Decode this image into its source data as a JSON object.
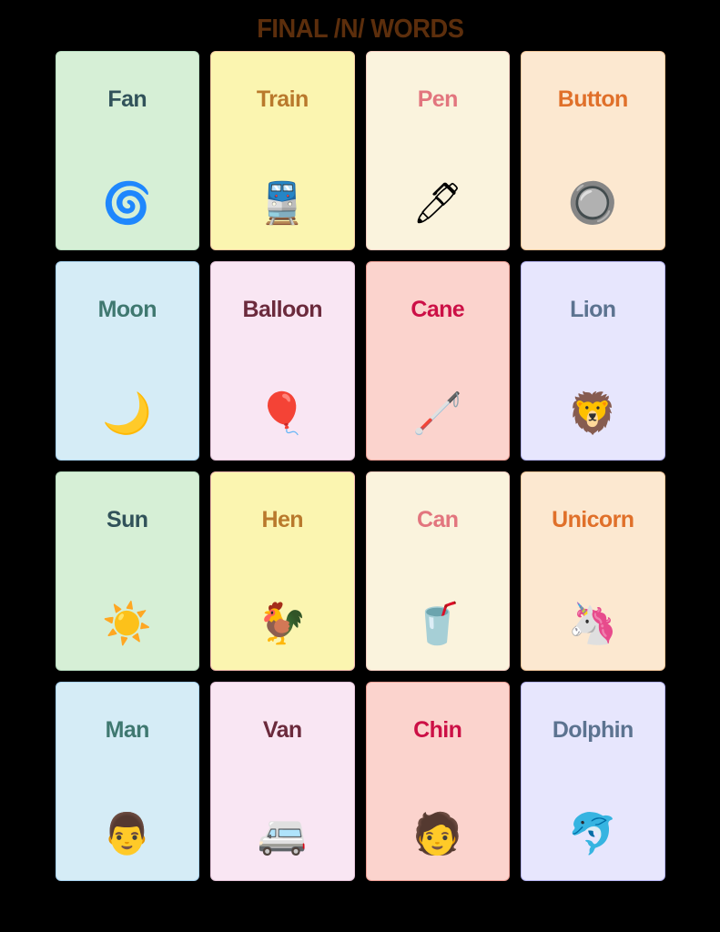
{
  "page": {
    "title": "FINAL /N/ WORDS",
    "title_color": "#5c2e0c",
    "background_color": "#000000"
  },
  "cards": [
    {
      "word": "Fan",
      "emoji": "🌀",
      "icon_name": "fan-icon",
      "bg": "#d6efd6",
      "border": "#b8dcc0",
      "text_color": "#31525a"
    },
    {
      "word": "Train",
      "emoji": "🚆",
      "icon_name": "train-icon",
      "bg": "#fbf5b0",
      "border": "#f3c9a0",
      "text_color": "#b9792c"
    },
    {
      "word": "Pen",
      "emoji": "🖊",
      "icon_name": "pen-icon",
      "bg": "#faf3dd",
      "border": "#f6cfc3",
      "text_color": "#e2757e"
    },
    {
      "word": "Button",
      "emoji": "🔘",
      "icon_name": "button-icon",
      "bg": "#fce8d0",
      "border": "#f3c79a",
      "text_color": "#e0702a"
    },
    {
      "word": "Moon",
      "emoji": "🌙",
      "icon_name": "moon-icon",
      "bg": "#d5ecf6",
      "border": "#a8d3f0",
      "text_color": "#3f7870"
    },
    {
      "word": "Balloon",
      "emoji": "🎈",
      "icon_name": "balloon-icon",
      "bg": "#f9e6f3",
      "border": "#e3c3d8",
      "text_color": "#6b2a3c"
    },
    {
      "word": "Cane",
      "emoji": "🦯",
      "icon_name": "cane-icon",
      "bg": "#fbd3cd",
      "border": "#ee9f96",
      "text_color": "#cc1046"
    },
    {
      "word": "Lion",
      "emoji": "🦁",
      "icon_name": "lion-icon",
      "bg": "#e7e6fd",
      "border": "#b6b4f2",
      "text_color": "#5c7390"
    },
    {
      "word": "Sun",
      "emoji": "☀️",
      "icon_name": "sun-icon",
      "bg": "#d6efd6",
      "border": "#b8dcc0",
      "text_color": "#31525a"
    },
    {
      "word": "Hen",
      "emoji": "🐓",
      "icon_name": "hen-icon",
      "bg": "#fbf5b0",
      "border": "#f3b8ae",
      "text_color": "#b9792c"
    },
    {
      "word": "Can",
      "emoji": "🥤",
      "icon_name": "can-icon",
      "bg": "#faf3dd",
      "border": "#f6cfc3",
      "text_color": "#e2757e"
    },
    {
      "word": "Unicorn",
      "emoji": "🦄",
      "icon_name": "unicorn-icon",
      "bg": "#fce8d0",
      "border": "#f3c79a",
      "text_color": "#e0702a"
    },
    {
      "word": "Man",
      "emoji": "👨",
      "icon_name": "man-icon",
      "bg": "#d5ecf6",
      "border": "#a8d3f0",
      "text_color": "#3f7870"
    },
    {
      "word": "Van",
      "emoji": "🚐",
      "icon_name": "van-icon",
      "bg": "#f9e6f3",
      "border": "#e3c3d8",
      "text_color": "#6b2a3c"
    },
    {
      "word": "Chin",
      "emoji": "🧑",
      "icon_name": "chin-icon",
      "bg": "#fbd3cd",
      "border": "#ee9f96",
      "text_color": "#cc1046"
    },
    {
      "word": "Dolphin",
      "emoji": "🐬",
      "icon_name": "dolphin-icon",
      "bg": "#e7e6fd",
      "border": "#b6b4f2",
      "text_color": "#5c7390"
    }
  ]
}
